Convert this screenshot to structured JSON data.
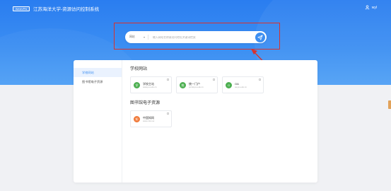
{
  "header": {
    "logo_text": "WebVPN",
    "app_title": "江苏海洋大学-资源访问控制系统",
    "user_name": "wyl"
  },
  "search": {
    "scope": "网站",
    "placeholder": "输入网站名称或访问地址关键词检索"
  },
  "sidebar": {
    "items": [
      {
        "label": "学校网站",
        "active": true
      },
      {
        "label": "图书馆电子资源",
        "active": false
      }
    ]
  },
  "sections": [
    {
      "title": "学校网站",
      "cards": [
        {
          "name": "学校主站",
          "url": "www.jou.edu.cn",
          "icon_char": "学",
          "icon_color": "#4caf50"
        },
        {
          "name": "统一门户",
          "url": "portal.jou.edu.cn",
          "icon_char": "统",
          "icon_color": "#4caf50"
        },
        {
          "name": "OA",
          "url": "oa.jou.edu.cn",
          "icon_char": "O",
          "icon_color": "#4caf50"
        }
      ]
    },
    {
      "title": "图书馆电子资源",
      "cards": [
        {
          "name": "中国知网",
          "url": "www.cnki.net",
          "icon_char": "知",
          "icon_color": "#f07a3a"
        }
      ]
    }
  ],
  "colors": {
    "accent": "#3e8ff1",
    "highlight": "#d9322c"
  }
}
